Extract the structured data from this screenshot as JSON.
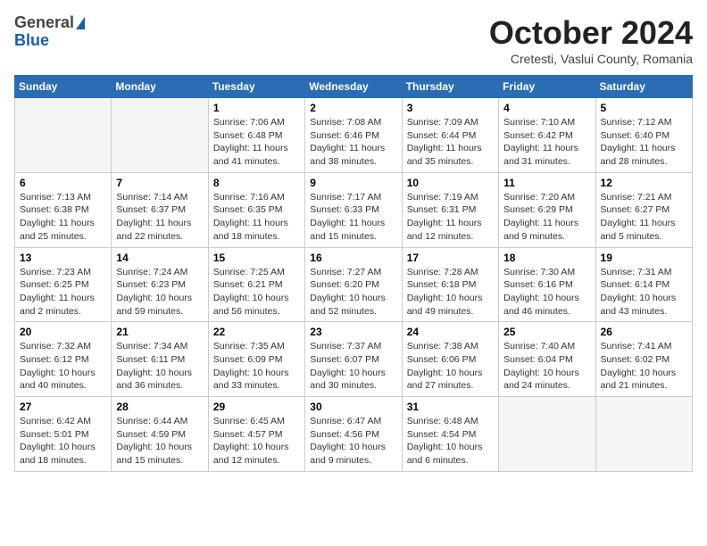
{
  "header": {
    "logo_general": "General",
    "logo_blue": "Blue",
    "month": "October 2024",
    "location": "Cretesti, Vaslui County, Romania"
  },
  "days_of_week": [
    "Sunday",
    "Monday",
    "Tuesday",
    "Wednesday",
    "Thursday",
    "Friday",
    "Saturday"
  ],
  "weeks": [
    [
      {
        "day": "",
        "info": ""
      },
      {
        "day": "",
        "info": ""
      },
      {
        "day": "1",
        "sunrise": "Sunrise: 7:06 AM",
        "sunset": "Sunset: 6:48 PM",
        "daylight": "Daylight: 11 hours and 41 minutes."
      },
      {
        "day": "2",
        "sunrise": "Sunrise: 7:08 AM",
        "sunset": "Sunset: 6:46 PM",
        "daylight": "Daylight: 11 hours and 38 minutes."
      },
      {
        "day": "3",
        "sunrise": "Sunrise: 7:09 AM",
        "sunset": "Sunset: 6:44 PM",
        "daylight": "Daylight: 11 hours and 35 minutes."
      },
      {
        "day": "4",
        "sunrise": "Sunrise: 7:10 AM",
        "sunset": "Sunset: 6:42 PM",
        "daylight": "Daylight: 11 hours and 31 minutes."
      },
      {
        "day": "5",
        "sunrise": "Sunrise: 7:12 AM",
        "sunset": "Sunset: 6:40 PM",
        "daylight": "Daylight: 11 hours and 28 minutes."
      }
    ],
    [
      {
        "day": "6",
        "sunrise": "Sunrise: 7:13 AM",
        "sunset": "Sunset: 6:38 PM",
        "daylight": "Daylight: 11 hours and 25 minutes."
      },
      {
        "day": "7",
        "sunrise": "Sunrise: 7:14 AM",
        "sunset": "Sunset: 6:37 PM",
        "daylight": "Daylight: 11 hours and 22 minutes."
      },
      {
        "day": "8",
        "sunrise": "Sunrise: 7:16 AM",
        "sunset": "Sunset: 6:35 PM",
        "daylight": "Daylight: 11 hours and 18 minutes."
      },
      {
        "day": "9",
        "sunrise": "Sunrise: 7:17 AM",
        "sunset": "Sunset: 6:33 PM",
        "daylight": "Daylight: 11 hours and 15 minutes."
      },
      {
        "day": "10",
        "sunrise": "Sunrise: 7:19 AM",
        "sunset": "Sunset: 6:31 PM",
        "daylight": "Daylight: 11 hours and 12 minutes."
      },
      {
        "day": "11",
        "sunrise": "Sunrise: 7:20 AM",
        "sunset": "Sunset: 6:29 PM",
        "daylight": "Daylight: 11 hours and 9 minutes."
      },
      {
        "day": "12",
        "sunrise": "Sunrise: 7:21 AM",
        "sunset": "Sunset: 6:27 PM",
        "daylight": "Daylight: 11 hours and 5 minutes."
      }
    ],
    [
      {
        "day": "13",
        "sunrise": "Sunrise: 7:23 AM",
        "sunset": "Sunset: 6:25 PM",
        "daylight": "Daylight: 11 hours and 2 minutes."
      },
      {
        "day": "14",
        "sunrise": "Sunrise: 7:24 AM",
        "sunset": "Sunset: 6:23 PM",
        "daylight": "Daylight: 10 hours and 59 minutes."
      },
      {
        "day": "15",
        "sunrise": "Sunrise: 7:25 AM",
        "sunset": "Sunset: 6:21 PM",
        "daylight": "Daylight: 10 hours and 56 minutes."
      },
      {
        "day": "16",
        "sunrise": "Sunrise: 7:27 AM",
        "sunset": "Sunset: 6:20 PM",
        "daylight": "Daylight: 10 hours and 52 minutes."
      },
      {
        "day": "17",
        "sunrise": "Sunrise: 7:28 AM",
        "sunset": "Sunset: 6:18 PM",
        "daylight": "Daylight: 10 hours and 49 minutes."
      },
      {
        "day": "18",
        "sunrise": "Sunrise: 7:30 AM",
        "sunset": "Sunset: 6:16 PM",
        "daylight": "Daylight: 10 hours and 46 minutes."
      },
      {
        "day": "19",
        "sunrise": "Sunrise: 7:31 AM",
        "sunset": "Sunset: 6:14 PM",
        "daylight": "Daylight: 10 hours and 43 minutes."
      }
    ],
    [
      {
        "day": "20",
        "sunrise": "Sunrise: 7:32 AM",
        "sunset": "Sunset: 6:12 PM",
        "daylight": "Daylight: 10 hours and 40 minutes."
      },
      {
        "day": "21",
        "sunrise": "Sunrise: 7:34 AM",
        "sunset": "Sunset: 6:11 PM",
        "daylight": "Daylight: 10 hours and 36 minutes."
      },
      {
        "day": "22",
        "sunrise": "Sunrise: 7:35 AM",
        "sunset": "Sunset: 6:09 PM",
        "daylight": "Daylight: 10 hours and 33 minutes."
      },
      {
        "day": "23",
        "sunrise": "Sunrise: 7:37 AM",
        "sunset": "Sunset: 6:07 PM",
        "daylight": "Daylight: 10 hours and 30 minutes."
      },
      {
        "day": "24",
        "sunrise": "Sunrise: 7:38 AM",
        "sunset": "Sunset: 6:06 PM",
        "daylight": "Daylight: 10 hours and 27 minutes."
      },
      {
        "day": "25",
        "sunrise": "Sunrise: 7:40 AM",
        "sunset": "Sunset: 6:04 PM",
        "daylight": "Daylight: 10 hours and 24 minutes."
      },
      {
        "day": "26",
        "sunrise": "Sunrise: 7:41 AM",
        "sunset": "Sunset: 6:02 PM",
        "daylight": "Daylight: 10 hours and 21 minutes."
      }
    ],
    [
      {
        "day": "27",
        "sunrise": "Sunrise: 6:42 AM",
        "sunset": "Sunset: 5:01 PM",
        "daylight": "Daylight: 10 hours and 18 minutes."
      },
      {
        "day": "28",
        "sunrise": "Sunrise: 6:44 AM",
        "sunset": "Sunset: 4:59 PM",
        "daylight": "Daylight: 10 hours and 15 minutes."
      },
      {
        "day": "29",
        "sunrise": "Sunrise: 6:45 AM",
        "sunset": "Sunset: 4:57 PM",
        "daylight": "Daylight: 10 hours and 12 minutes."
      },
      {
        "day": "30",
        "sunrise": "Sunrise: 6:47 AM",
        "sunset": "Sunset: 4:56 PM",
        "daylight": "Daylight: 10 hours and 9 minutes."
      },
      {
        "day": "31",
        "sunrise": "Sunrise: 6:48 AM",
        "sunset": "Sunset: 4:54 PM",
        "daylight": "Daylight: 10 hours and 6 minutes."
      },
      {
        "day": "",
        "info": ""
      },
      {
        "day": "",
        "info": ""
      }
    ]
  ]
}
